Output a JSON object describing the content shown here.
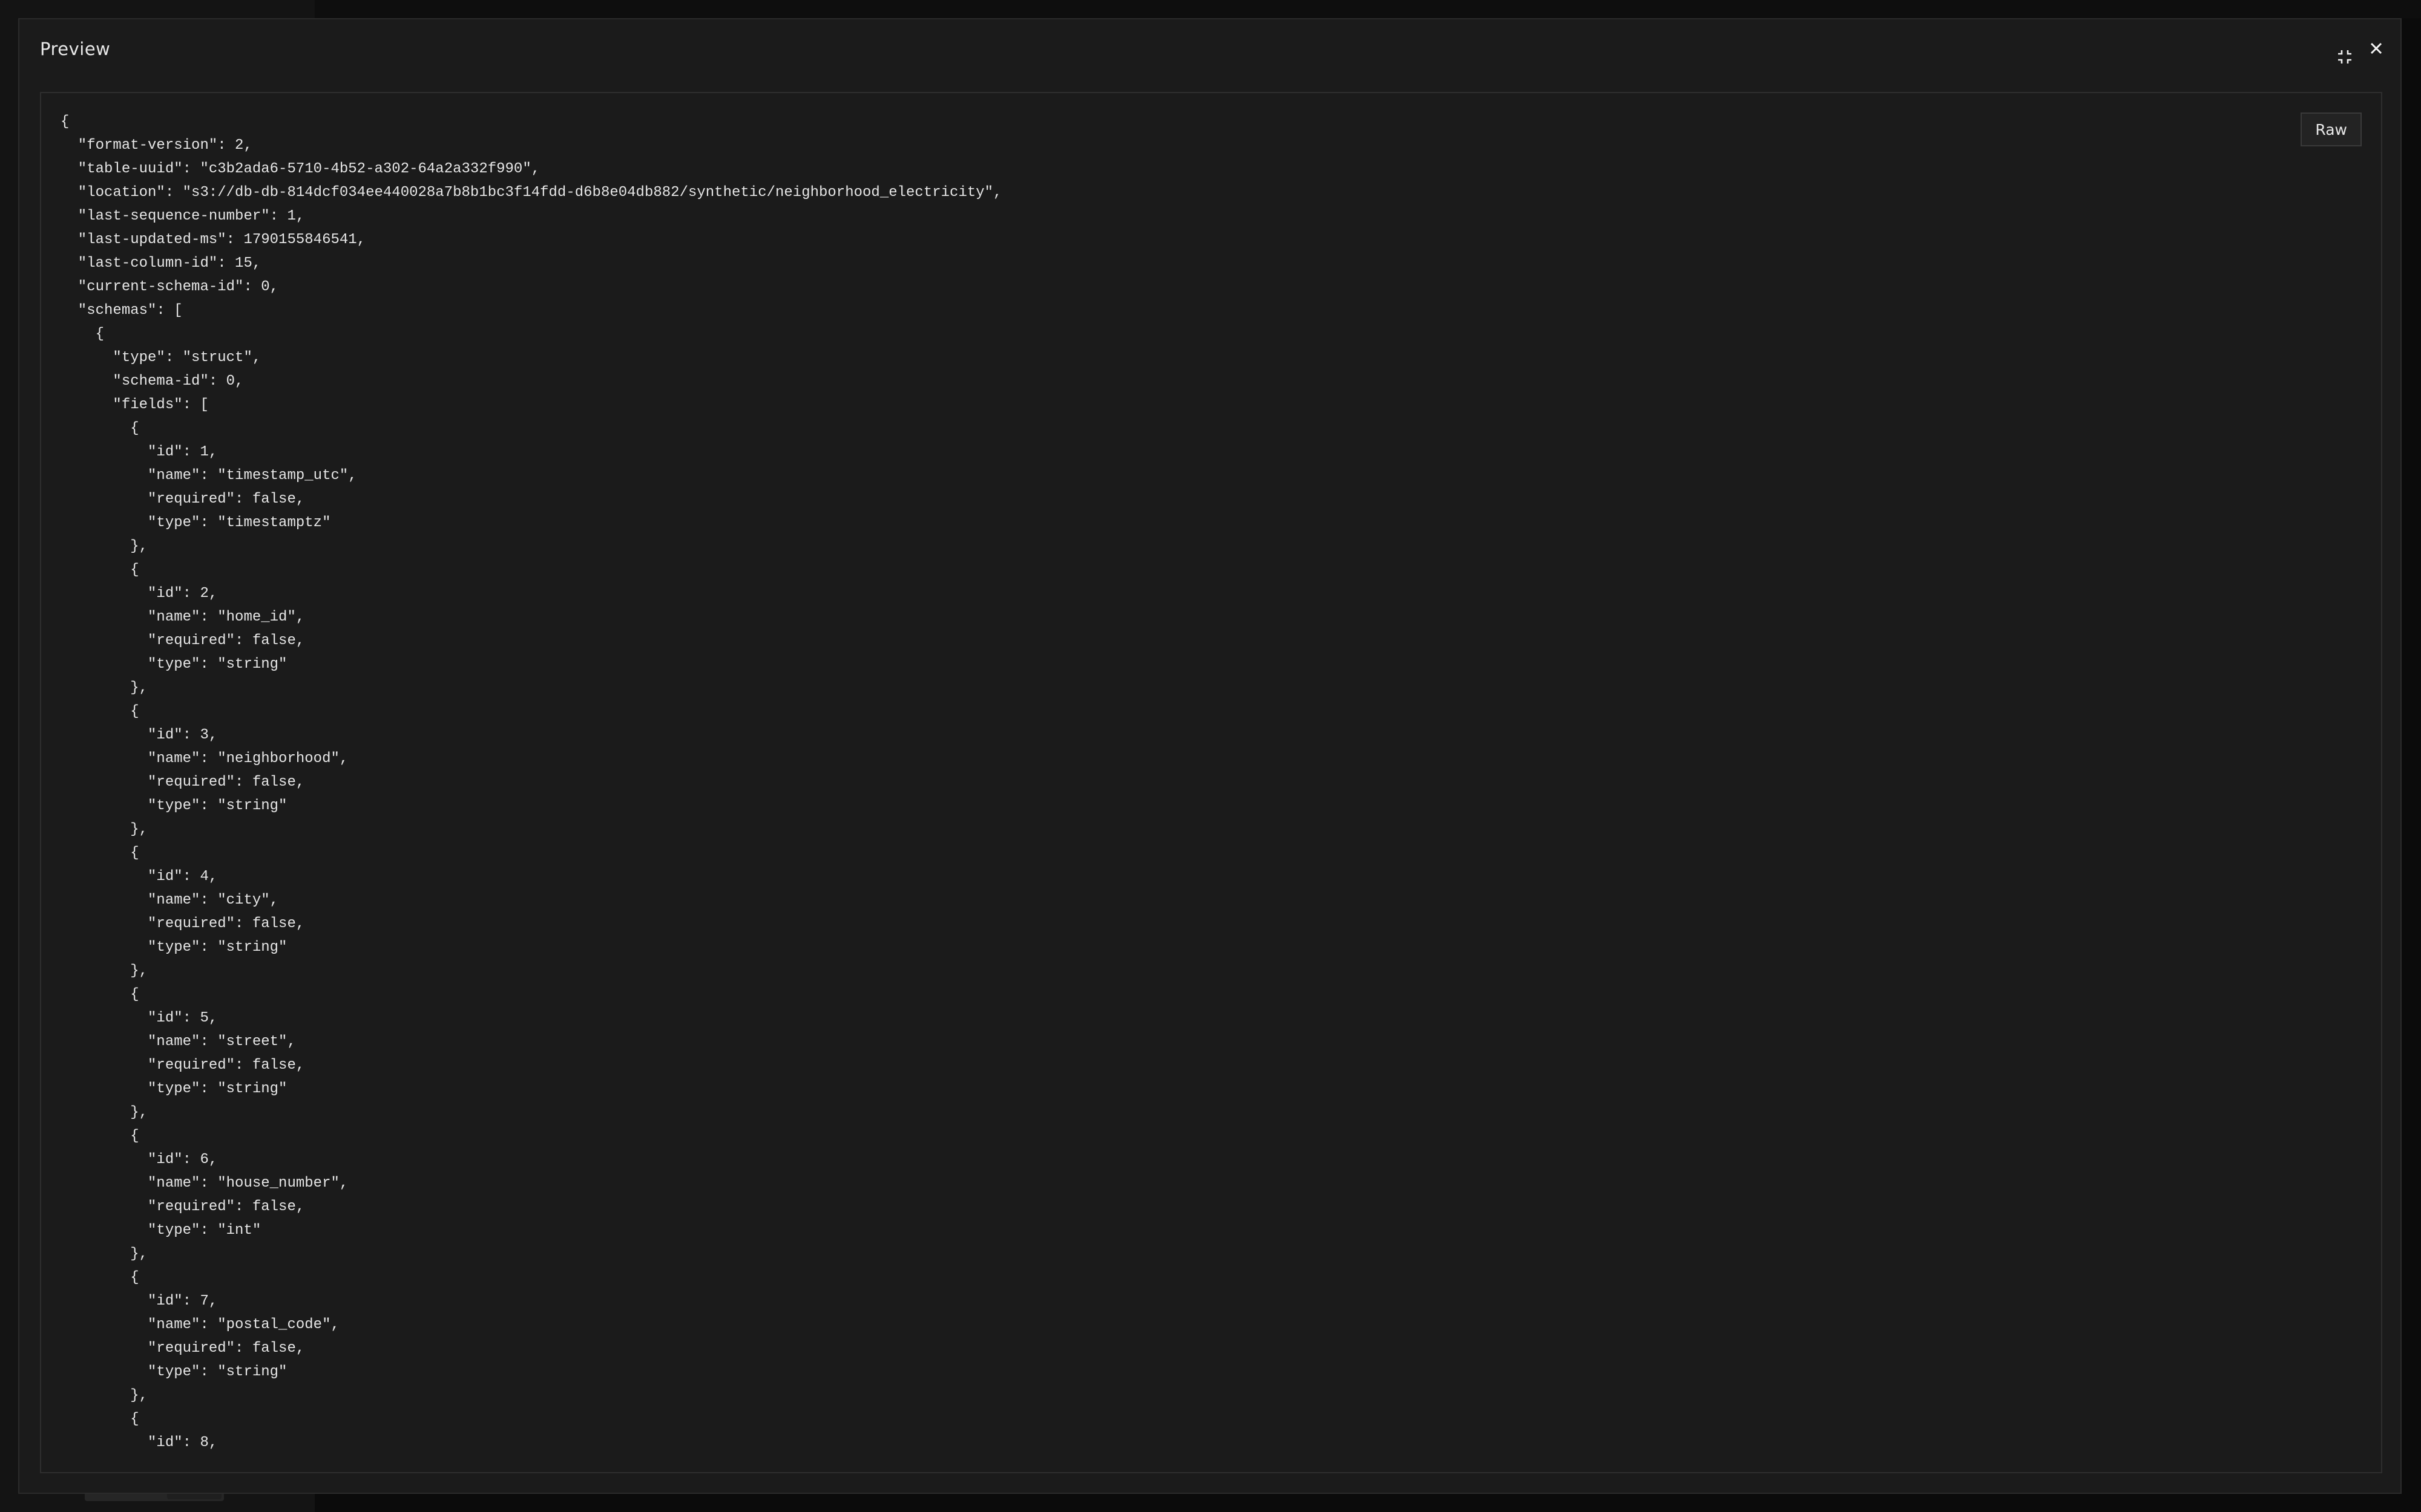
{
  "modal": {
    "title": "Preview",
    "collapse_icon": "collapse-icon",
    "close_icon": "close-icon",
    "raw_label": "Raw"
  },
  "json_lines": [
    "{",
    "  \"format-version\": 2,",
    "  \"table-uuid\": \"c3b2ada6-5710-4b52-a302-64a2a332f990\",",
    "  \"location\": \"s3://db-db-814dcf034ee440028a7b8b1bc3f14fdd-d6b8e04db882/synthetic/neighborhood_electricity\",",
    "  \"last-sequence-number\": 1,",
    "  \"last-updated-ms\": 1790155846541,",
    "  \"last-column-id\": 15,",
    "  \"current-schema-id\": 0,",
    "  \"schemas\": [",
    "    {",
    "      \"type\": \"struct\",",
    "      \"schema-id\": 0,",
    "      \"fields\": [",
    "        {",
    "          \"id\": 1,",
    "          \"name\": \"timestamp_utc\",",
    "          \"required\": false,",
    "          \"type\": \"timestamptz\"",
    "        },",
    "        {",
    "          \"id\": 2,",
    "          \"name\": \"home_id\",",
    "          \"required\": false,",
    "          \"type\": \"string\"",
    "        },",
    "        {",
    "          \"id\": 3,",
    "          \"name\": \"neighborhood\",",
    "          \"required\": false,",
    "          \"type\": \"string\"",
    "        },",
    "        {",
    "          \"id\": 4,",
    "          \"name\": \"city\",",
    "          \"required\": false,",
    "          \"type\": \"string\"",
    "        },",
    "        {",
    "          \"id\": 5,",
    "          \"name\": \"street\",",
    "          \"required\": false,",
    "          \"type\": \"string\"",
    "        },",
    "        {",
    "          \"id\": 6,",
    "          \"name\": \"house_number\",",
    "          \"required\": false,",
    "          \"type\": \"int\"",
    "        },",
    "        {",
    "          \"id\": 7,",
    "          \"name\": \"postal_code\",",
    "          \"required\": false,",
    "          \"type\": \"string\"",
    "        },",
    "        {",
    "          \"id\": 8,"
  ]
}
